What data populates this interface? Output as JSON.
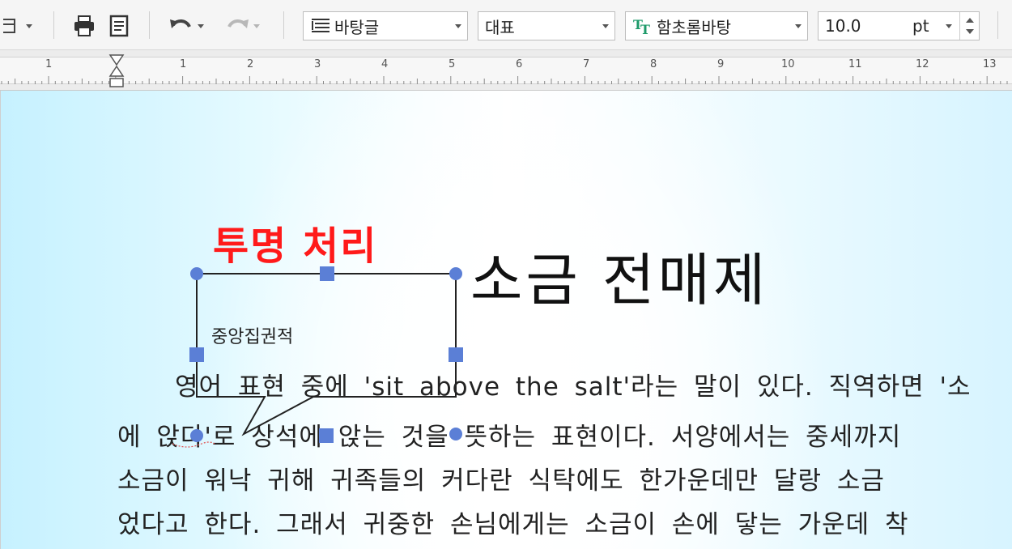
{
  "toolbar": {
    "style_value": "바탕글",
    "language_value": "대표",
    "font_value": "함초롬바탕",
    "font_size_value": "10.0",
    "font_size_unit": "pt"
  },
  "ruler": {
    "marks": [
      "1",
      "1",
      "2",
      "3",
      "4",
      "5",
      "6",
      "7",
      "8",
      "9",
      "10",
      "11",
      "12",
      "13"
    ]
  },
  "document": {
    "annotation": "투명 처리",
    "title": "소금 전매제",
    "callout_text": "중앙집권적",
    "lines": [
      "영어 표현 중에 'sit above the salt'라는 말이 있다. 직역하면 '소",
      "에 앉다'로 상석에 앉는 것을 뜻하는 표현이다. 서양에서는 중세까지",
      "소금이 워낙 귀해 귀족들의 커다란 식탁에도 한가운데만 달랑 소금",
      "었다고 한다. 그래서 귀중한 손님에게는 소금이 손에 닿는 가운데 착"
    ]
  },
  "colors": {
    "annotation": "#ff1a1a",
    "handle": "#5b7fd6",
    "page_edge": "#c6f1ff"
  },
  "icons": [
    "layout-icon",
    "print-icon",
    "page-view-icon",
    "undo-icon",
    "redo-icon",
    "paragraph-style-icon",
    "font-tt-icon"
  ]
}
